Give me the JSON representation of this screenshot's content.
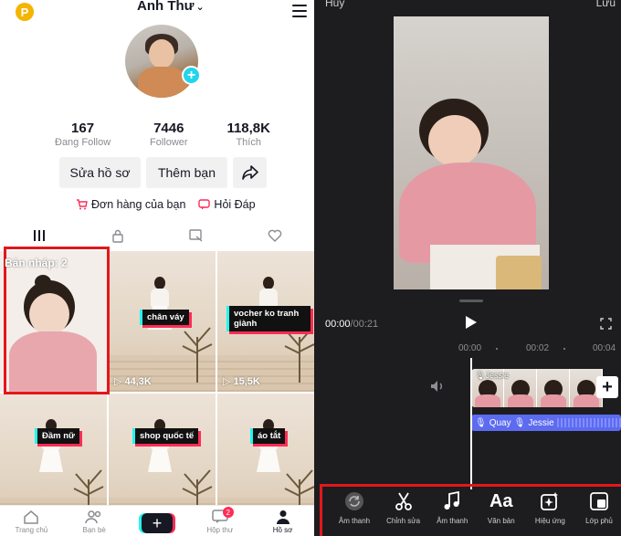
{
  "left": {
    "header": {
      "username": "Anh Thư",
      "coin_badge": "P"
    },
    "stats": [
      {
        "value": "167",
        "label": "Đang Follow"
      },
      {
        "value": "7446",
        "label": "Follower"
      },
      {
        "value": "118,8K",
        "label": "Thích"
      }
    ],
    "buttons": {
      "edit_profile": "Sửa hồ sơ",
      "add_friends": "Thêm bạn"
    },
    "links": {
      "orders": "Đơn hàng của bạn",
      "qa": "Hỏi Đáp"
    },
    "grid": {
      "draft_label": "Bản nháp: 2",
      "videos": [
        {
          "caption": "chân váy",
          "views": "44,3K"
        },
        {
          "caption": "vocher ko tranh giành",
          "views": "15,5K"
        },
        {
          "caption": "Đầm nữ",
          "views": ""
        },
        {
          "caption": "shop quốc tế",
          "views": ""
        },
        {
          "caption": "áo tắt",
          "views": ""
        }
      ]
    },
    "bottom_nav": [
      {
        "label": "Trang chủ"
      },
      {
        "label": "Bạn bè"
      },
      {
        "label": ""
      },
      {
        "label": "Hộp thư",
        "badge": "2"
      },
      {
        "label": "Hồ sơ"
      }
    ]
  },
  "right": {
    "top_left": "Hủy",
    "top_right": "Lưu",
    "time": {
      "current": "00:00",
      "duration": "/00:21"
    },
    "ruler": [
      "00:00",
      "00:02",
      "00:04"
    ],
    "clip_label": "Jessie",
    "audio": {
      "record": "Quay",
      "voice": "Jessie"
    },
    "toolbar": [
      {
        "label": "Âm thanh",
        "icon": "sync-icon"
      },
      {
        "label": "Chỉnh sửa",
        "icon": "scissors-icon"
      },
      {
        "label": "Âm thanh",
        "icon": "music-icon"
      },
      {
        "label": "Văn bản",
        "icon": "text-icon"
      },
      {
        "label": "Hiệu ứng",
        "icon": "effects-icon"
      },
      {
        "label": "Lớp phủ",
        "icon": "overlay-icon"
      }
    ]
  },
  "colors": {
    "accent_red": "#fe2c55",
    "accent_cyan": "#25f4ee",
    "highlight_box": "#e3171b",
    "audio_track": "#5c6bf0"
  }
}
